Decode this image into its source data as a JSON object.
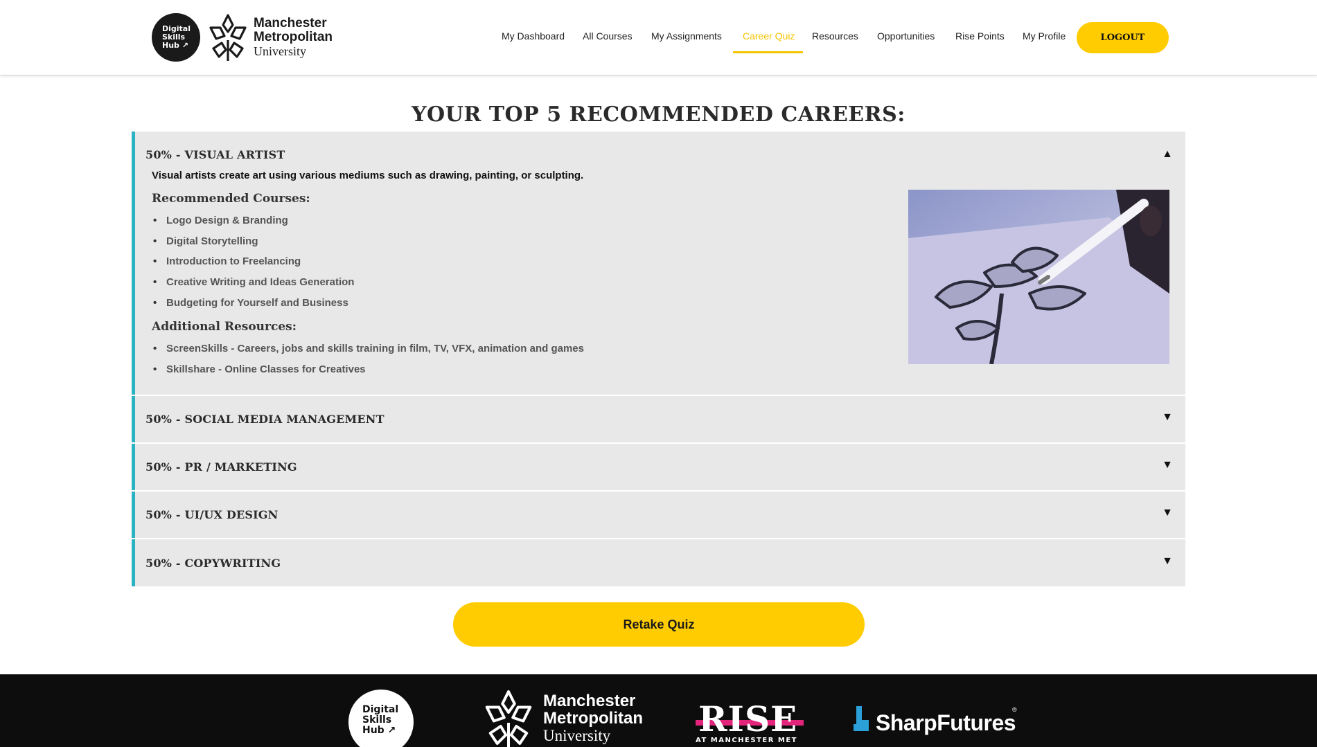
{
  "brand": {
    "hub_badge": "Digital Skills Hub",
    "hub_badge_lines": [
      "Digital",
      "Skills",
      "Hub ↗"
    ],
    "university_line1": "Manchester",
    "university_line2": "Metropolitan",
    "university_line3": "University"
  },
  "nav": {
    "items": [
      {
        "label": "My Dashboard",
        "active": false
      },
      {
        "label": "All Courses",
        "active": false
      },
      {
        "label": "My Assignments",
        "active": false
      },
      {
        "label": "Career Quiz",
        "active": true
      },
      {
        "label": "Resources",
        "active": false
      },
      {
        "label": "Opportunities",
        "active": false
      },
      {
        "label": "Rise Points",
        "active": false
      },
      {
        "label": "My Profile",
        "active": false
      }
    ],
    "logout_label": "LOGOUT"
  },
  "page": {
    "title": "YOUR TOP 5 RECOMMENDED CAREERS:"
  },
  "careers": [
    {
      "title": "50% - VISUAL ARTIST",
      "expanded": true,
      "toggle": "▲",
      "description": "Visual artists create art using various mediums such as drawing, painting, or sculpting.",
      "courses_heading": "Recommended Courses:",
      "courses": [
        "Logo Design & Branding",
        "Digital Storytelling",
        "Introduction to Freelancing",
        "Creative Writing and Ideas Generation",
        "Budgeting for Yourself and Business"
      ],
      "resources_heading": "Additional Resources:",
      "resources": [
        "ScreenSkills - Careers, jobs and skills training in film, TV, VFX, animation and games",
        "Skillshare - Online Classes for Creatives"
      ]
    },
    {
      "title": "50% - SOCIAL MEDIA MANAGEMENT",
      "expanded": false,
      "toggle": "▼"
    },
    {
      "title": "50% - PR / MARKETING",
      "expanded": false,
      "toggle": "▼"
    },
    {
      "title": "50% - UI/UX DESIGN",
      "expanded": false,
      "toggle": "▼"
    },
    {
      "title": "50% - COPYWRITING",
      "expanded": false,
      "toggle": "▼"
    }
  ],
  "actions": {
    "retake_label": "Retake Quiz"
  },
  "footer": {
    "hub_badge_lines": [
      "Digital",
      "Skills",
      "Hub ↗"
    ],
    "university_line1": "Manchester",
    "university_line2": "Metropolitan",
    "university_line3": "University",
    "rise": "RISE",
    "rise_sub": "AT MANCHESTER MET",
    "sharp": "SharpFutures",
    "sharp_reg": "®"
  },
  "colors": {
    "accent_yellow": "#fecc00",
    "active_nav": "#f5c400",
    "accordion_bar": "#2bb3c4",
    "accordion_bg": "#e8e8e8",
    "footer_bg": "#0d0d0d",
    "rise_pink": "#e2247a",
    "sharp_blue": "#2a9fd8"
  }
}
